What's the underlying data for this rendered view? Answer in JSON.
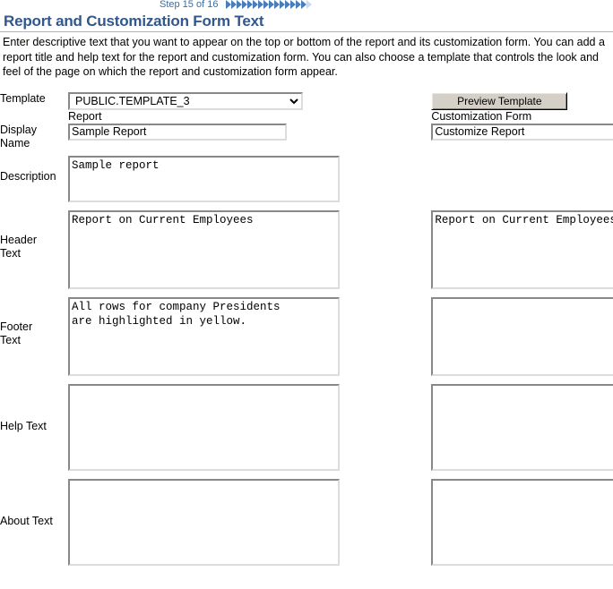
{
  "step_indicator": {
    "label": "Step 15 of 16",
    "total_steps": 16,
    "completed_steps": 15,
    "accent_color": "#4a7dba",
    "label_color": "#3a6ea5"
  },
  "page": {
    "title": "Report and Customization Form Text",
    "title_color": "#31578c",
    "rule_color": "#c3b68a",
    "intro": "Enter descriptive text that you want to appear on the top or bottom of the report and its customization form. You can add a report title and help text for the report and customization form. You can also choose a template that controls the look and feel of the page on which the report and customization form appear."
  },
  "form": {
    "template": {
      "label": "Template",
      "selected": "PUBLIC.TEMPLATE_3",
      "options": [
        "PUBLIC.TEMPLATE_3"
      ]
    },
    "preview_button": "Preview Template",
    "column_headings": {
      "report": "Report",
      "customization_form": "Customization Form"
    },
    "rows": [
      {
        "label": "Display\nName",
        "type": "input",
        "report_value": "Sample Report",
        "form_value": "Customize Report"
      },
      {
        "label": "Description",
        "type": "textarea",
        "report_value": "Sample report",
        "form_value": null
      },
      {
        "label": "Header\nText",
        "type": "textarea",
        "report_value": "Report on Current Employees",
        "form_value": "Report on Current Employees"
      },
      {
        "label": "Footer\nText",
        "type": "textarea",
        "report_value": "All rows for company Presidents\nare highlighted in yellow.",
        "form_value": ""
      },
      {
        "label": "Help Text",
        "type": "textarea",
        "report_value": "",
        "form_value": ""
      },
      {
        "label": "About Text",
        "type": "textarea",
        "report_value": "",
        "form_value": ""
      }
    ]
  }
}
